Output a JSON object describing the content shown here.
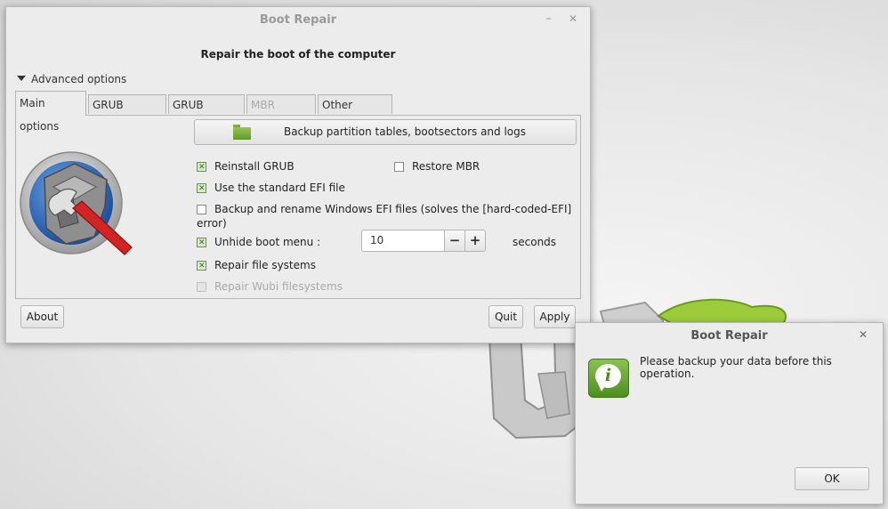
{
  "main_window": {
    "title": "Boot Repair",
    "minimize_glyph": "–",
    "close_glyph": "✕",
    "heading": "Repair the boot of the computer",
    "advanced_options_label": "Advanced options",
    "tabs": [
      {
        "label": "Main options",
        "active": true,
        "enabled": true
      },
      {
        "label": "GRUB location",
        "active": false,
        "enabled": true
      },
      {
        "label": "GRUB options",
        "active": false,
        "enabled": true
      },
      {
        "label": "MBR options",
        "active": false,
        "enabled": false
      },
      {
        "label": "Other options",
        "active": false,
        "enabled": true
      }
    ],
    "backup_button_label": "Backup partition tables, bootsectors and logs",
    "options": {
      "reinstall_grub": {
        "label": "Reinstall GRUB",
        "checked": true
      },
      "restore_mbr": {
        "label": "Restore MBR",
        "checked": false
      },
      "standard_efi": {
        "label": "Use the standard EFI file",
        "checked": true
      },
      "backup_rename_efi": {
        "label": "Backup and rename Windows EFI files (solves the [hard-coded-EFI] error)",
        "checked": false
      },
      "unhide_boot_menu": {
        "label": "Unhide boot menu :",
        "checked": true
      },
      "repair_fs": {
        "label": "Repair file systems",
        "checked": true
      },
      "repair_wubi": {
        "label": "Repair Wubi filesystems",
        "checked": false,
        "enabled": false
      }
    },
    "boot_menu_seconds": "10",
    "spin_minus": "−",
    "spin_plus": "+",
    "seconds_label": "seconds",
    "about_button": "About",
    "quit_button": "Quit",
    "apply_button": "Apply"
  },
  "dialog": {
    "title": "Boot Repair",
    "close_glyph": "✕",
    "icon": "info-icon",
    "icon_glyph": "i",
    "message": "Please backup your data before this operation.",
    "ok_button": "OK"
  },
  "colors": {
    "window_bg": "#ececec",
    "checked_box": "#d9ecc8",
    "info_icon_green": "#6aa83a"
  }
}
